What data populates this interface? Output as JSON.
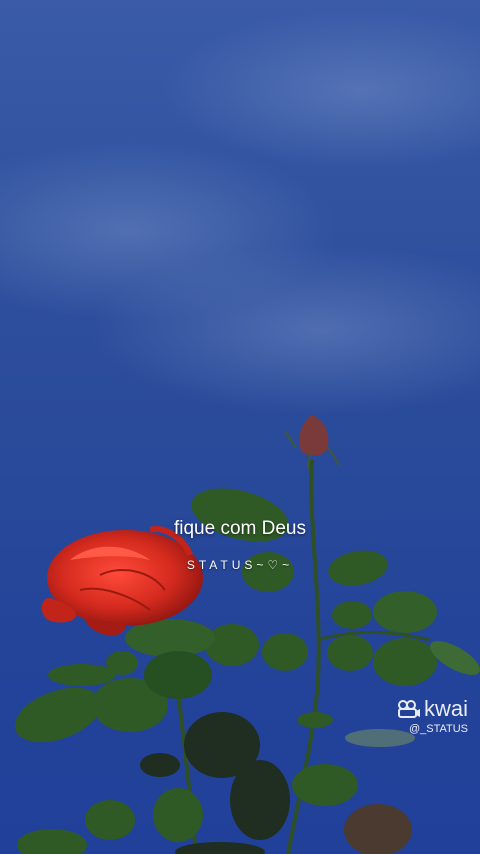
{
  "caption": {
    "title": "fique com Deus",
    "subtitle": "STATUS~♡~"
  },
  "watermark": {
    "brand": "kwai",
    "handle": "@_STATUS",
    "icon": "camera-icon"
  },
  "colors": {
    "sky": "#2a4a9a",
    "rose": "#d42a1e",
    "leaf": "#2f5a26",
    "text": "#ffffff"
  }
}
